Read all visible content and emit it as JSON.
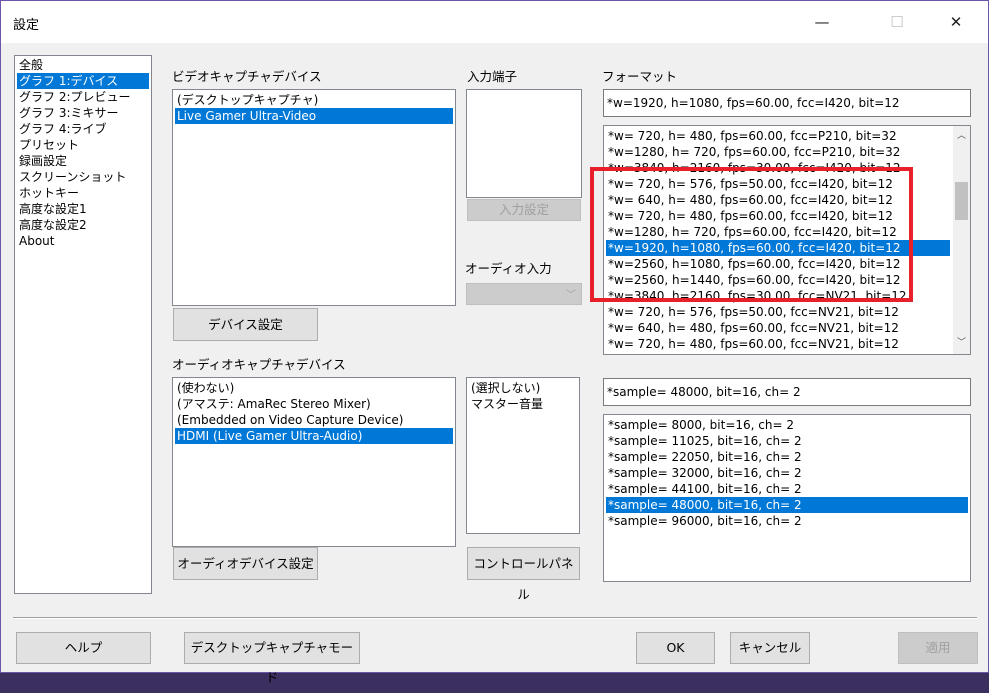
{
  "window": {
    "title": "設定",
    "minimize": "—",
    "maximize": "☐",
    "close": "✕"
  },
  "nav": {
    "items": [
      "全般",
      "グラフ 1:デバイス",
      "グラフ 2:プレビュー",
      "グラフ 3:ミキサー",
      "グラフ 4:ライブ",
      "プリセット",
      "録画設定",
      "スクリーンショット",
      "ホットキー",
      "高度な設定1",
      "高度な設定2",
      "About"
    ],
    "selected_index": 1
  },
  "video_device": {
    "label": "ビデオキャプチャデバイス",
    "items": [
      "(デスクトップキャプチャ)",
      "Live Gamer Ultra-Video"
    ],
    "selected_index": 1,
    "settings_button": "デバイス設定"
  },
  "input_terminal": {
    "label": "入力端子",
    "settings_button": "入力設定"
  },
  "audio_input": {
    "label": "オーディオ入力",
    "value": ""
  },
  "format": {
    "label": "フォーマット",
    "current": "*w=1920, h=1080, fps=60.00,  fcc=I420, bit=12",
    "items": [
      "*w= 720, h= 480, fps=60.00,  fcc=P210, bit=32",
      "*w=1280, h= 720, fps=60.00,  fcc=P210, bit=32",
      "*w=3840, h=2160, fps=30.00,  fcc=I420, bit=12",
      "*w= 720, h= 576, fps=50.00,  fcc=I420, bit=12",
      "*w= 640, h= 480, fps=60.00,  fcc=I420, bit=12",
      "*w= 720, h= 480, fps=60.00,  fcc=I420, bit=12",
      "*w=1280, h= 720, fps=60.00,  fcc=I420, bit=12",
      "*w=1920, h=1080, fps=60.00,  fcc=I420, bit=12",
      "*w=2560, h=1080, fps=60.00,  fcc=I420, bit=12",
      "*w=2560, h=1440, fps=60.00,  fcc=I420, bit=12",
      "*w=3840, h=2160, fps=30.00,  fcc=NV21, bit=12",
      "*w= 720, h= 576, fps=50.00,  fcc=NV21, bit=12",
      "*w= 640, h= 480, fps=60.00,  fcc=NV21, bit=12",
      "*w= 720, h= 480, fps=60.00,  fcc=NV21, bit=12"
    ],
    "selected_index": 7,
    "highlight_color": "#e8202a"
  },
  "audio_device": {
    "label": "オーディオキャプチャデバイス",
    "items": [
      "(使わない)",
      "(アマステ: AmaRec Stereo Mixer)",
      "(Embedded on Video Capture Device)",
      "HDMI (Live Gamer Ultra-Audio)"
    ],
    "selected_index": 3,
    "settings_button": "オーディオデバイス設定"
  },
  "mixer": {
    "items": [
      "(選択しない)",
      "マスター音量"
    ],
    "control_panel_button": "コントロールパネル"
  },
  "audio_format": {
    "current": "*sample= 48000, bit=16, ch= 2",
    "items": [
      "*sample=  8000, bit=16, ch= 2",
      "*sample= 11025, bit=16, ch= 2",
      "*sample= 22050, bit=16, ch= 2",
      "*sample= 32000, bit=16, ch= 2",
      "*sample= 44100, bit=16, ch= 2",
      "*sample= 48000, bit=16, ch= 2",
      "*sample= 96000, bit=16, ch= 2"
    ],
    "selected_index": 5
  },
  "footer": {
    "help": "ヘルプ",
    "desktop_mode": "デスクトップキャプチャモード",
    "ok": "OK",
    "cancel": "キャンセル",
    "apply": "適用"
  },
  "colors": {
    "selection": "#0078d7",
    "window_bg": "#f0f0f0"
  }
}
